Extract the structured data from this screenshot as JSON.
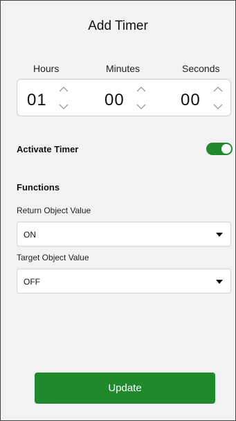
{
  "header": {
    "title": "Add Timer"
  },
  "timer": {
    "labels": {
      "hours": "Hours",
      "minutes": "Minutes",
      "seconds": "Seconds"
    },
    "values": {
      "hours": "01",
      "minutes": "00",
      "seconds": "00"
    }
  },
  "activate": {
    "label": "Activate Timer",
    "enabled": true,
    "color": "#1e8a2c"
  },
  "functions": {
    "title": "Functions",
    "return_object": {
      "label": "Return Object Value",
      "value": "ON"
    },
    "target_object": {
      "label": "Target Object Value",
      "value": "OFF"
    }
  },
  "actions": {
    "update_label": "Update",
    "update_color": "#1e8a2c"
  }
}
